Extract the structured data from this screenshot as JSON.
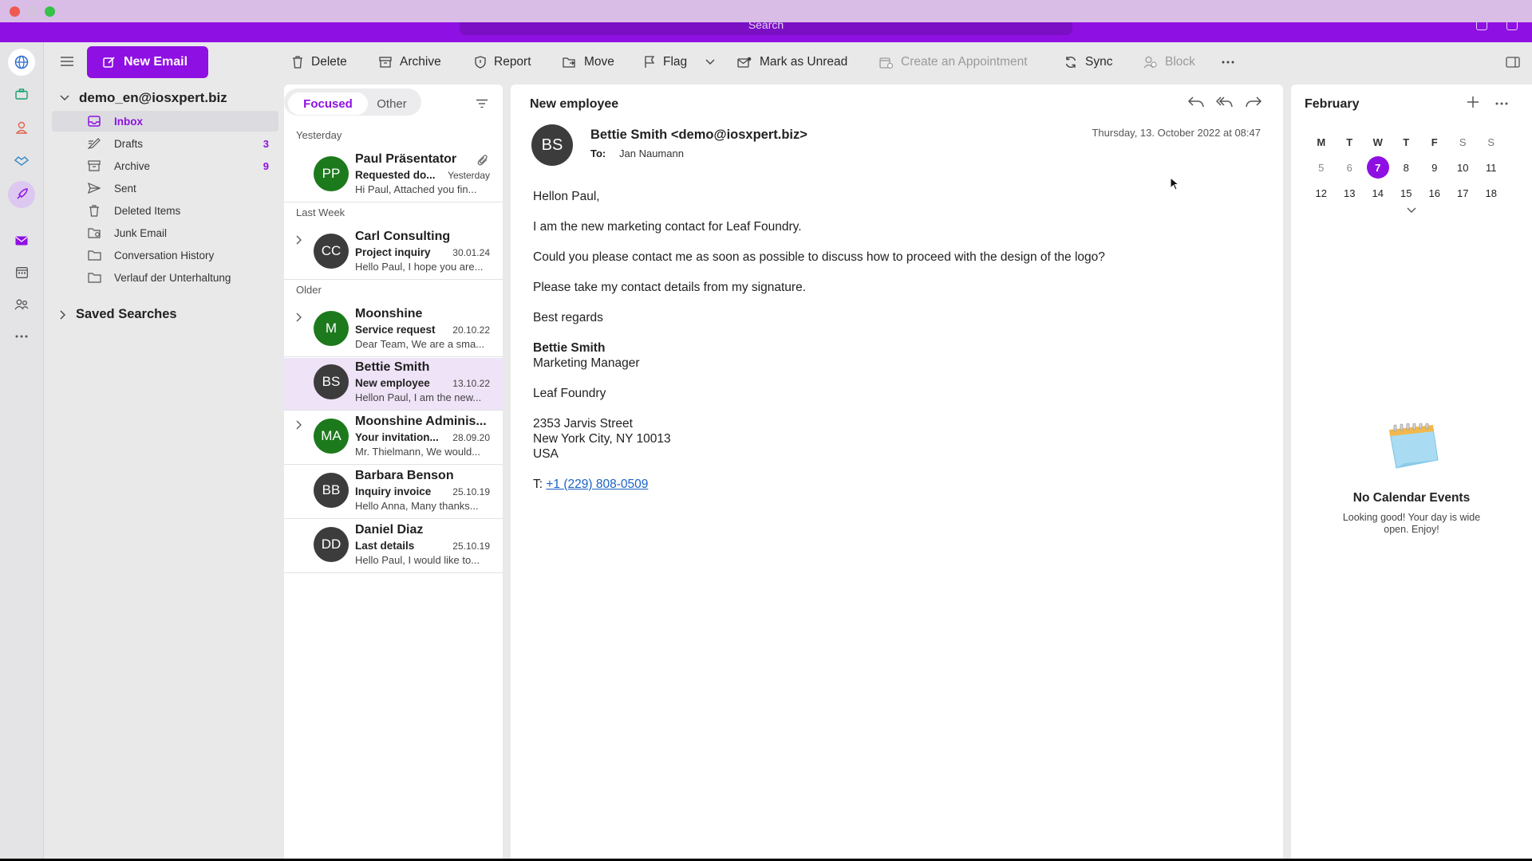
{
  "search": {
    "placeholder": "Search"
  },
  "toolbar": {
    "new_email": "New Email",
    "delete": "Delete",
    "archive": "Archive",
    "report": "Report",
    "move": "Move",
    "flag": "Flag",
    "mark_unread": "Mark as Unread",
    "create_appointment": "Create an Appointment",
    "sync": "Sync",
    "block": "Block"
  },
  "account": "demo_en@iosxpert.biz",
  "folders": [
    {
      "label": "Inbox",
      "icon": "inbox-icon",
      "count": ""
    },
    {
      "label": "Drafts",
      "icon": "drafts-icon",
      "count": "3"
    },
    {
      "label": "Archive",
      "icon": "archive-icon",
      "count": "9"
    },
    {
      "label": "Sent",
      "icon": "sent-icon",
      "count": ""
    },
    {
      "label": "Deleted Items",
      "icon": "trash-icon",
      "count": ""
    },
    {
      "label": "Junk Email",
      "icon": "junk-icon",
      "count": ""
    },
    {
      "label": "Conversation History",
      "icon": "folder-icon",
      "count": ""
    },
    {
      "label": "Verlauf der Unterhaltung",
      "icon": "folder-icon",
      "count": ""
    }
  ],
  "saved_searches": "Saved Searches",
  "list": {
    "tabs": {
      "focused": "Focused",
      "other": "Other"
    },
    "groups": {
      "yesterday": "Yesterday",
      "last_week": "Last Week",
      "older": "Older"
    },
    "messages": [
      {
        "initials": "PP",
        "color": "#1c7a1c",
        "sender": "Paul Präsentator",
        "subject": "Requested do...",
        "date": "Yesterday",
        "preview": "Hi Paul, Attached you fin..."
      },
      {
        "initials": "CC",
        "color": "#3c3c3c",
        "sender": "Carl Consulting",
        "subject": "Project inquiry",
        "date": "30.01.24",
        "preview": "Hello Paul, I hope you are..."
      },
      {
        "initials": "M",
        "color": "#1c7a1c",
        "sender": "Moonshine",
        "subject": "Service request",
        "date": "20.10.22",
        "preview": "Dear Team, We are a sma..."
      },
      {
        "initials": "BS",
        "color": "#3c3c3c",
        "sender": "Bettie Smith",
        "subject": "New employee",
        "date": "13.10.22",
        "preview": "Hellon Paul, I am the new..."
      },
      {
        "initials": "MA",
        "color": "#1c7a1c",
        "sender": "Moonshine Adminis...",
        "subject": "Your invitation...",
        "date": "28.09.20",
        "preview": "Mr. Thielmann, We would..."
      },
      {
        "initials": "BB",
        "color": "#3c3c3c",
        "sender": "Barbara Benson",
        "subject": "Inquiry invoice",
        "date": "25.10.19",
        "preview": "Hello Anna, Many thanks..."
      },
      {
        "initials": "DD",
        "color": "#3c3c3c",
        "sender": "Daniel Diaz",
        "subject": "Last details",
        "date": "25.10.19",
        "preview": "Hello Paul, I would like to..."
      }
    ]
  },
  "reader": {
    "subject": "New employee",
    "initials": "BS",
    "from": "Bettie Smith <demo@iosxpert.biz>",
    "to_label": "To:",
    "to": "Jan Naumann",
    "date": "Thursday, 13. October 2022 at 08:47",
    "body": [
      "Hellon Paul,",
      "I am the new marketing contact for Leaf Foundry.",
      "Could you please contact me as soon as possible to discuss how to proceed with the design of the logo?",
      "Please take my contact details from my signature.",
      "Best regards"
    ],
    "signature": {
      "name": "Bettie Smith",
      "title": "Marketing Manager",
      "company": "Leaf Foundry",
      "street": "2353 Jarvis Street",
      "city": "New York City, NY 10013",
      "country": "USA",
      "phone_label": "T:",
      "phone": "+1 (229) 808-0509"
    }
  },
  "calendar": {
    "month": "February",
    "weekdays": [
      "M",
      "T",
      "W",
      "T",
      "F",
      "S",
      "S"
    ],
    "weeks": [
      [
        "5",
        "6",
        "7",
        "8",
        "9",
        "10",
        "11"
      ],
      [
        "12",
        "13",
        "14",
        "15",
        "16",
        "17",
        "18"
      ]
    ],
    "today": "7",
    "empty_title": "No Calendar Events",
    "empty_sub": "Looking good! Your day is wide open. Enjoy!"
  },
  "colors": {
    "accent": "#8f10e2",
    "selected_row": "#efe3f7",
    "link": "#1a62c5"
  }
}
